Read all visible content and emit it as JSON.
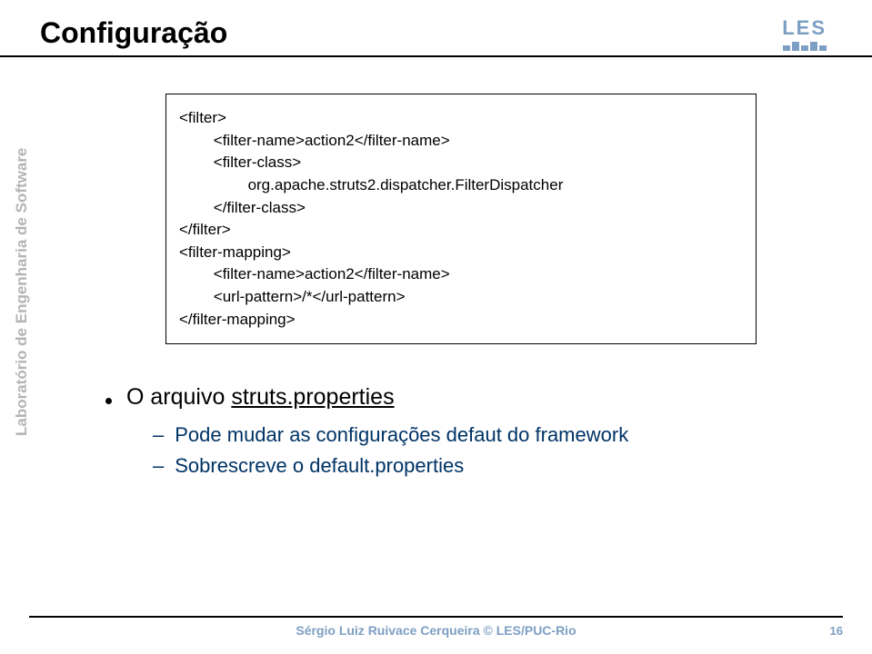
{
  "title": "Configuração",
  "logo": {
    "text": "LES"
  },
  "sidebar": "Laboratório de Engenharia de Software",
  "code": {
    "l1": "<filter>",
    "l2": "        <filter-name>action2</filter-name>",
    "l3": "        <filter-class>",
    "l4": "                org.apache.struts2.dispatcher.FilterDispatcher",
    "l5": "        </filter-class>",
    "l6": "</filter>",
    "l7": "<filter-mapping>",
    "l8": "        <filter-name>action2</filter-name>",
    "l9": "        <url-pattern>/*</url-pattern>",
    "l10": "</filter-mapping>"
  },
  "bullet": {
    "main_pre": "O arquivo ",
    "main_link": "struts.properties",
    "sub1": "Pode mudar as configurações defaut do framework",
    "sub2": "Sobrescreve o default.properties"
  },
  "footer": {
    "text": "Sérgio Luiz Ruivace Cerqueira © LES/PUC-Rio",
    "page": "16"
  }
}
